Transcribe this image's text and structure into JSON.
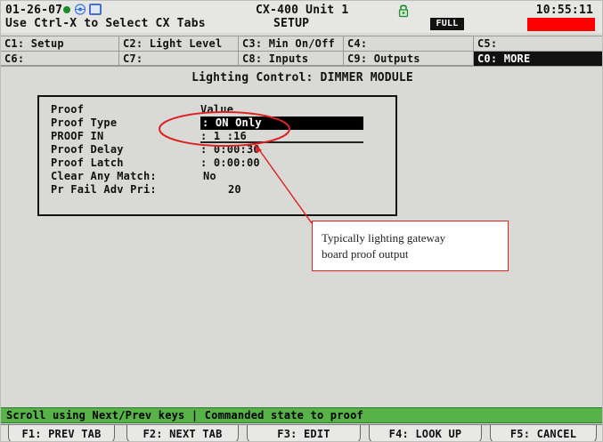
{
  "header": {
    "date": "01-26-07",
    "hint": "Use Ctrl-X to Select CX Tabs",
    "unit": "CX-400 Unit 1",
    "mode": "SETUP",
    "full_badge": "FULL",
    "time": "10:55:11",
    "icons": [
      "green-status-dot",
      "network-icon",
      "window-icon",
      "lock-icon"
    ],
    "status_color": "#ff0000"
  },
  "tabs": [
    {
      "label": "C1: Setup"
    },
    {
      "label": "C2: Light Level"
    },
    {
      "label": "C3: Min On/Off"
    },
    {
      "label": "C4:"
    },
    {
      "label": "C5:"
    },
    {
      "label": "C6:"
    },
    {
      "label": "C7:"
    },
    {
      "label": "C8: Inputs"
    },
    {
      "label": "C9: Outputs"
    },
    {
      "label": "C0: MORE"
    }
  ],
  "main": {
    "title": "Lighting Control: DIMMER MODULE",
    "table": {
      "header_label": "Proof",
      "header_value": "Value",
      "rows": [
        {
          "label": "Proof Type",
          "value": ": ON Only"
        },
        {
          "label": "PROOF IN",
          "value": ": 1          :16"
        },
        {
          "label": "Proof Delay",
          "value": ":  0:00:30"
        },
        {
          "label": "Proof Latch",
          "value": ":  0:00:00"
        },
        {
          "label": "Clear Any Match:",
          "value": "No"
        },
        {
          "label": "Pr Fail Adv Pri:",
          "value": "20"
        }
      ]
    }
  },
  "annotation": {
    "line1": "Typically lighting gateway",
    "line2": "board proof output"
  },
  "status": {
    "text": "Scroll using Next/Prev keys  | Commanded state to proof",
    "color": "#57b347"
  },
  "fkeys": [
    {
      "label": "F1: PREV TAB"
    },
    {
      "label": "F2: NEXT TAB"
    },
    {
      "label": "F3: EDIT"
    },
    {
      "label": "F4: LOOK UP"
    },
    {
      "label": "F5: CANCEL"
    }
  ],
  "colors": {
    "accent_red": "#ff0000",
    "status_green": "#57b347",
    "annotation_red": "#d22"
  }
}
